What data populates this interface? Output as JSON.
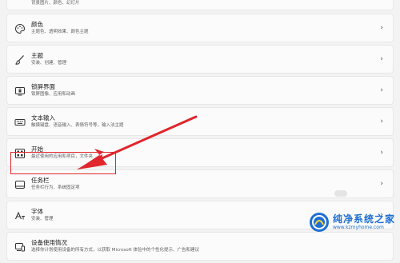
{
  "settings": {
    "top_sub": "背景图片、颜色、幻灯片",
    "items": [
      {
        "title": "颜色",
        "sub": "主题色、透明效果、颜色主题",
        "icon": "palette-icon"
      },
      {
        "title": "主题",
        "sub": "安装、创建、管理",
        "icon": "brush-icon"
      },
      {
        "title": "锁屏界面",
        "sub": "锁屏图像、应用和动画",
        "icon": "lock-screen-icon"
      },
      {
        "title": "文本输入",
        "sub": "触摸键盘、语音输入、表情符号等，输入法主题",
        "icon": "keyboard-icon"
      },
      {
        "title": "开始",
        "sub": "最近使用的应用和项目，文件夹",
        "icon": "start-menu-icon"
      },
      {
        "title": "任务栏",
        "sub": "任务栏行为、系统固定项",
        "icon": "taskbar-icon"
      },
      {
        "title": "字体",
        "sub": "安装、管理",
        "icon": "font-icon"
      },
      {
        "title": "设备使用情况",
        "sub": "选择你计划使用设备的所有方式，以获取 Microsoft 体验中的个性化提示、广告和建议",
        "icon": "device-usage-icon"
      }
    ],
    "chevron": "›"
  },
  "annotation": {
    "color": "#e0262c"
  },
  "watermark": {
    "title": "纯净系统之家",
    "url": "www.kzmyhome.com"
  }
}
